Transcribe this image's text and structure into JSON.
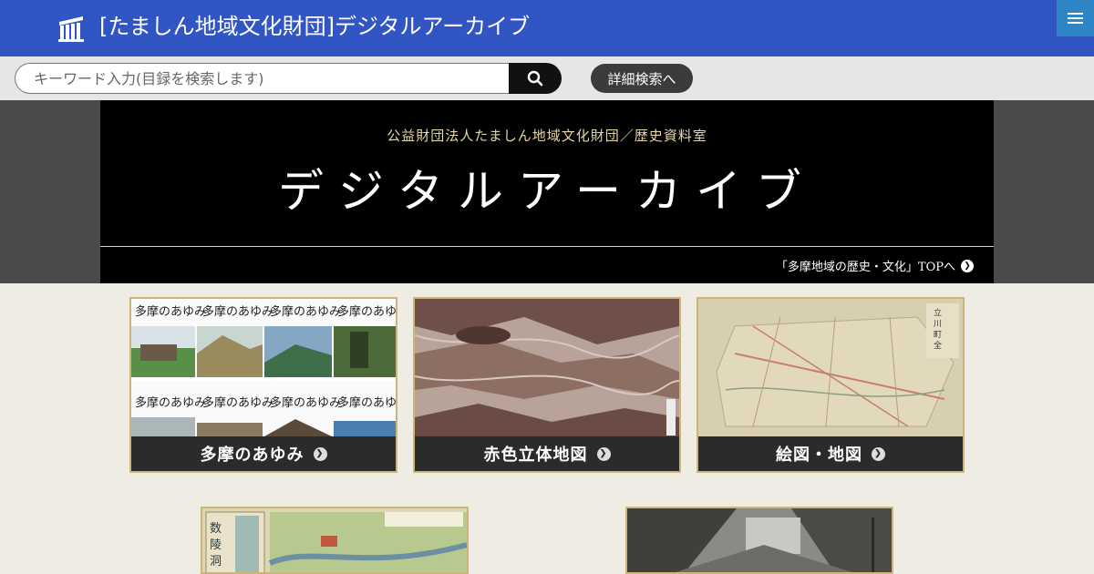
{
  "header": {
    "site_title": "[たましん地域文化財団]デジタルアーカイブ",
    "logo_icon": "building-columns-icon",
    "menu_icon": "hamburger-menu-icon"
  },
  "search": {
    "placeholder": "キーワード入力(目録を検索します)",
    "value": "",
    "button_icon": "search-icon",
    "advanced_label": "詳細検索へ"
  },
  "hero": {
    "subtitle": "公益財団法人たましん地域文化財団／歴史資料室",
    "title": "デジタルアーカイブ",
    "link_label": "「多摩地域の歴史・文化」TOPへ"
  },
  "cards": [
    {
      "label": "多摩のあゆみ",
      "thumb_icon": "magazine-covers-image"
    },
    {
      "label": "赤色立体地図",
      "thumb_icon": "relief-map-image"
    },
    {
      "label": "絵図・地図",
      "thumb_icon": "old-map-image"
    }
  ],
  "cards_row2": [
    {
      "thumb_icon": "illustrated-guide-map-image"
    },
    {
      "thumb_icon": "old-photo-image"
    }
  ],
  "colors": {
    "header_bg": "#3155c3",
    "menu_bg": "#2f86c7",
    "hero_bg": "#000000",
    "card_border": "#cbb57b",
    "card_label_bg": "#2b2b2b",
    "page_bg": "#efece4"
  }
}
